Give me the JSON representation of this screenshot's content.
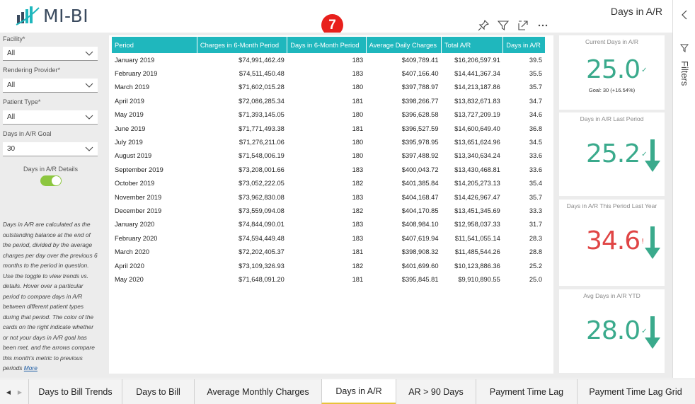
{
  "header": {
    "logo_text": "MI-BI",
    "page_title": "Days in A/R",
    "marker_label": "7"
  },
  "slicers": {
    "facility": {
      "label": "Facility*",
      "value": "All"
    },
    "rendering_provider": {
      "label": "Rendering Provider*",
      "value": "All"
    },
    "patient_type": {
      "label": "Patient Type*",
      "value": "All"
    },
    "goal": {
      "label": "Days in A/R Goal",
      "value": "30"
    },
    "details_toggle": {
      "label": "Days in A/R Details",
      "on": true
    }
  },
  "description": {
    "text": "Days in A/R are calculated as the outstanding balance at the end of the period, divided by the average charges per day over the previous 6 months to the period in question. Use the toggle to view trends vs. details. Hover over a particular period to compare days in A/R between different patient types during that period. The color of the cards on the right indicate whether or not your days in A/R goal has been met, and the arrows compare this month's metric to previous periods",
    "more_link": "More"
  },
  "table": {
    "columns": [
      "Period",
      "Charges in 6-Month Period",
      "Days in 6-Month Period",
      "Average Daily Charges",
      "Total A/R",
      "Days in A/R"
    ],
    "rows": [
      [
        "January 2019",
        "$74,991,462.49",
        "183",
        "$409,789.41",
        "$16,206,597.91",
        "39.5"
      ],
      [
        "February 2019",
        "$74,511,450.48",
        "183",
        "$407,166.40",
        "$14,441,367.34",
        "35.5"
      ],
      [
        "March 2019",
        "$71,602,015.28",
        "180",
        "$397,788.97",
        "$14,213,187.86",
        "35.7"
      ],
      [
        "April 2019",
        "$72,086,285.34",
        "181",
        "$398,266.77",
        "$13,832,671.83",
        "34.7"
      ],
      [
        "May 2019",
        "$71,393,145.05",
        "180",
        "$396,628.58",
        "$13,727,209.19",
        "34.6"
      ],
      [
        "June 2019",
        "$71,771,493.38",
        "181",
        "$396,527.59",
        "$14,600,649.40",
        "36.8"
      ],
      [
        "July 2019",
        "$71,276,211.06",
        "180",
        "$395,978.95",
        "$13,651,624.96",
        "34.5"
      ],
      [
        "August 2019",
        "$71,548,006.19",
        "180",
        "$397,488.92",
        "$13,340,634.24",
        "33.6"
      ],
      [
        "September 2019",
        "$73,208,001.66",
        "183",
        "$400,043.72",
        "$13,430,468.81",
        "33.6"
      ],
      [
        "October 2019",
        "$73,052,222.05",
        "182",
        "$401,385.84",
        "$14,205,273.13",
        "35.4"
      ],
      [
        "November 2019",
        "$73,962,830.08",
        "183",
        "$404,168.47",
        "$14,426,967.47",
        "35.7"
      ],
      [
        "December 2019",
        "$73,559,094.08",
        "182",
        "$404,170.85",
        "$13,451,345.69",
        "33.3"
      ],
      [
        "January 2020",
        "$74,844,090.01",
        "183",
        "$408,984.10",
        "$12,958,037.33",
        "31.7"
      ],
      [
        "February 2020",
        "$74,594,449.48",
        "183",
        "$407,619.94",
        "$11,541,055.14",
        "28.3"
      ],
      [
        "March 2020",
        "$72,202,405.37",
        "181",
        "$398,908.32",
        "$11,485,544.26",
        "28.8"
      ],
      [
        "April 2020",
        "$73,109,326.93",
        "182",
        "$401,699.60",
        "$10,123,886.36",
        "25.2"
      ],
      [
        "May 2020",
        "$71,648,091.20",
        "181",
        "$395,845.81",
        "$9,910,890.55",
        "25.0"
      ]
    ]
  },
  "kpis": [
    {
      "title": "Current Days in A/R",
      "value": "25.0",
      "indicator": "✓",
      "goal_text": "Goal: 30 (+16.54%)",
      "color": "#3aaa8c",
      "arrow": null
    },
    {
      "title": "Days in A/R Last Period",
      "value": "25.2",
      "indicator": "✓",
      "goal_text": "",
      "color": "#3aaa8c",
      "arrow": "down"
    },
    {
      "title": "Days in A/R This Period Last Year",
      "value": "34.6",
      "indicator": "!",
      "goal_text": "",
      "color": "#e04545",
      "arrow": "down"
    },
    {
      "title": "Avg Days in A/R YTD",
      "value": "28.0",
      "indicator": "✓",
      "goal_text": "",
      "color": "#3aaa8c",
      "arrow": "down"
    }
  ],
  "colors": {
    "accent": "#1fb7bd",
    "good": "#3aaa8c",
    "bad": "#e04545",
    "arrow": "#3aaa8c",
    "toggle": "#8cc63f",
    "active_tab": "#e8c33a"
  },
  "filters_pane": {
    "label": "Filters"
  },
  "tabs": {
    "items": [
      "Days to Bill Trends",
      "Days to Bill",
      "Average Monthly Charges",
      "Days in A/R",
      "AR > 90 Days",
      "Payment Time Lag",
      "Payment Time Lag Grid"
    ],
    "active_index": 3
  }
}
